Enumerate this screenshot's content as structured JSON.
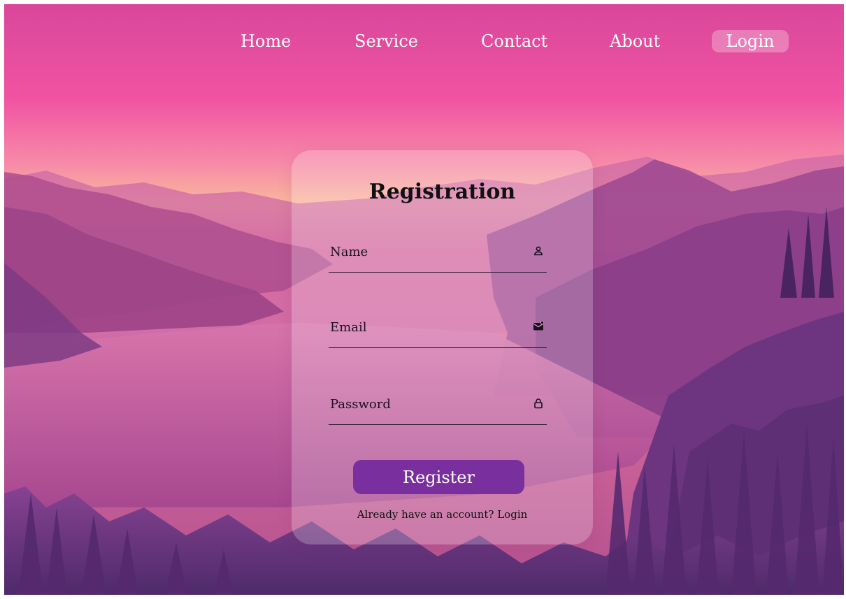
{
  "nav": {
    "items": [
      {
        "label": "Home"
      },
      {
        "label": "Service"
      },
      {
        "label": "Contact"
      },
      {
        "label": "About"
      }
    ],
    "login_label": "Login"
  },
  "form": {
    "title": "Registration",
    "fields": {
      "name": {
        "placeholder": "Name",
        "value": "",
        "icon": "person-icon"
      },
      "email": {
        "placeholder": "Email",
        "value": "",
        "icon": "mail-icon"
      },
      "password": {
        "placeholder": "Password",
        "value": "",
        "icon": "lock-icon"
      }
    },
    "submit_label": "Register",
    "footer_prompt": "Already have an account?",
    "footer_link": "Login"
  },
  "colors": {
    "accent": "#7a2f9e",
    "sky_top": "#e8509c",
    "sky_glow": "#f7b59a",
    "mountains": "#8a3f8c"
  }
}
